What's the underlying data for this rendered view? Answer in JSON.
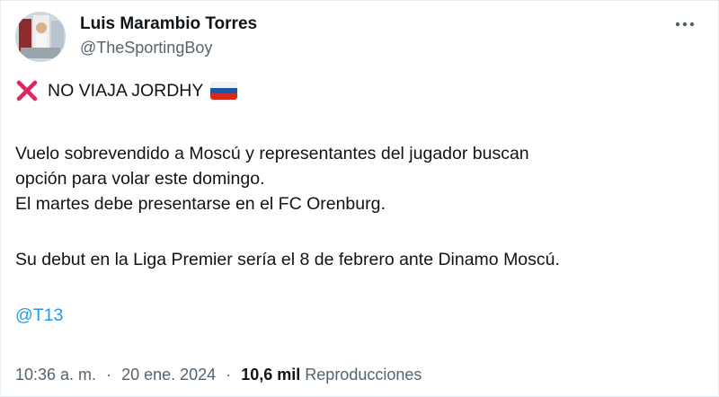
{
  "author": {
    "display_name": "Luis Marambio Torres",
    "handle": "@TheSportingBoy",
    "avatar_icon": "profile-photo"
  },
  "tweet": {
    "headline": "NO VIAJA JORDHY",
    "headline_icons": [
      "cross-mark-icon",
      "russia-flag-icon"
    ],
    "paragraph1_line1": "Vuelo sobrevendido a Moscú y representantes del jugador buscan",
    "paragraph1_line2": "opción para volar este domingo.",
    "paragraph1_line3": "El martes debe presentarse en el FC Orenburg.",
    "paragraph2": "Su debut en la Liga Premier sería el 8 de febrero ante Dinamo Moscú.",
    "mention": "@T13"
  },
  "meta": {
    "time": "10:36 a. m.",
    "separator": "·",
    "date": "20 ene. 2024",
    "views_count": "10,6 mil",
    "views_label": "Reproducciones"
  },
  "colors": {
    "link": "#1d9bf0",
    "secondary_text": "#536471",
    "primary_text": "#0f1419",
    "cross": "#e0245e"
  }
}
